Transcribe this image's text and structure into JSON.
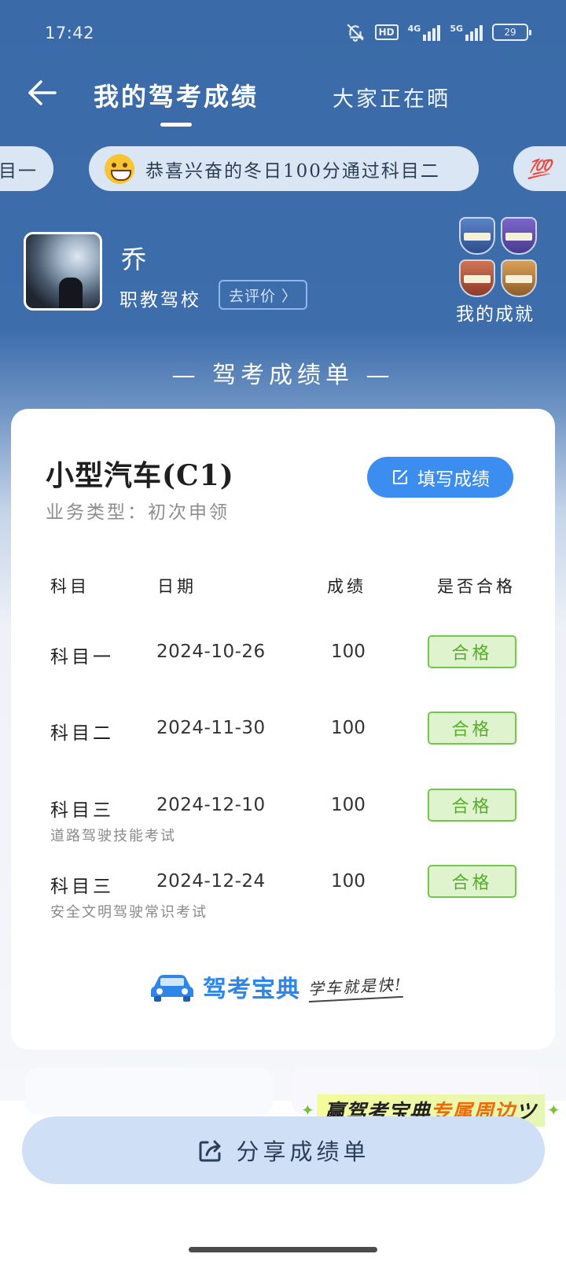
{
  "status_bar": {
    "time": "17:42",
    "hd_label": "HD",
    "net1": "4G",
    "net2": "5G",
    "battery": "29"
  },
  "nav": {
    "title": "我的驾考成绩",
    "tab2": "大家正在晒"
  },
  "ticker": {
    "left": "目一",
    "main": "恭喜兴奋的冬日100分通过科目二",
    "right": "💯"
  },
  "profile": {
    "name": "乔",
    "school": "职教驾校",
    "review_button": "去评价 〉",
    "achievements_label": "我的成就"
  },
  "sheet_title": "— 驾考成绩单 —",
  "card": {
    "car_type": "小型汽车(C1)",
    "business_type": "业务类型：初次申领",
    "fill_button": "填写成绩",
    "headers": {
      "subject": "科目",
      "date": "日期",
      "score": "成绩",
      "passed": "是否合格"
    },
    "rows": [
      {
        "subject": "科目一",
        "date": "2024-10-26",
        "score": "100",
        "passed": "合格",
        "sub": ""
      },
      {
        "subject": "科目二",
        "date": "2024-11-30",
        "score": "100",
        "passed": "合格",
        "sub": ""
      },
      {
        "subject": "科目三",
        "date": "2024-12-10",
        "score": "100",
        "passed": "合格",
        "sub": "道路驾驶技能考试"
      },
      {
        "subject": "科目三",
        "date": "2024-12-24",
        "score": "100",
        "passed": "合格",
        "sub": "安全文明驾驶常识考试"
      }
    ],
    "brand_name": "驾考宝典",
    "brand_slogan": "学车就是快!"
  },
  "promo": {
    "prefix": "赢驾考宝典",
    "highlight": "专属周边",
    "suffix": "ツ"
  },
  "share_button": "分享成绩单",
  "colors": {
    "primary_blue": "#3a6ba8",
    "button_blue": "#3b8ef0",
    "pass_green": "#55ad2a"
  }
}
